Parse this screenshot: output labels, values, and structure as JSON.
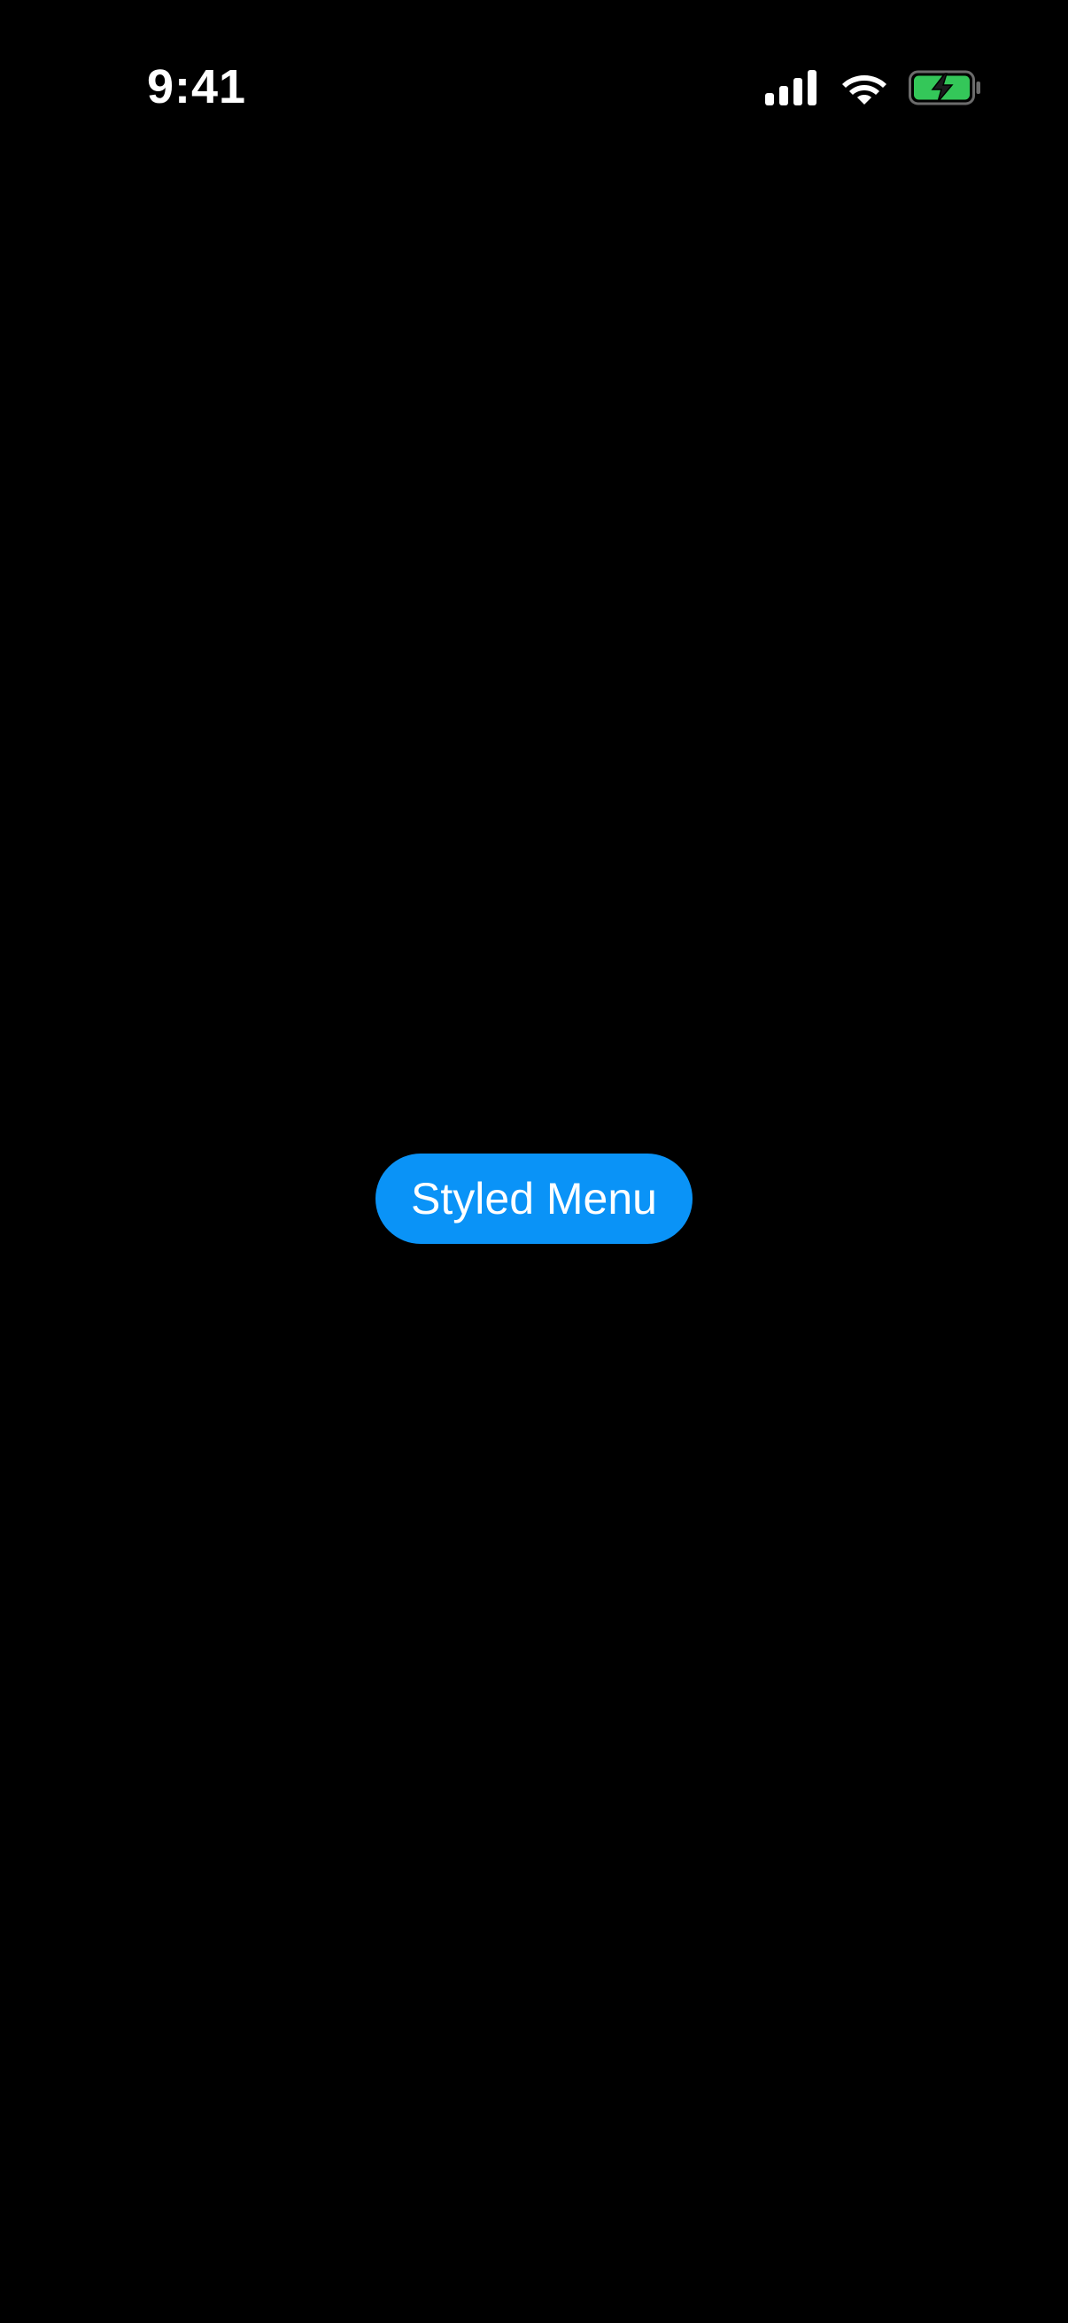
{
  "status_bar": {
    "time": "9:41",
    "icons": [
      "cellular-signal-icon",
      "wifi-icon",
      "battery-charging-icon"
    ],
    "battery_color": "#34c759"
  },
  "main": {
    "button_label": "Styled Menu",
    "button_color": "#0a93f7"
  }
}
